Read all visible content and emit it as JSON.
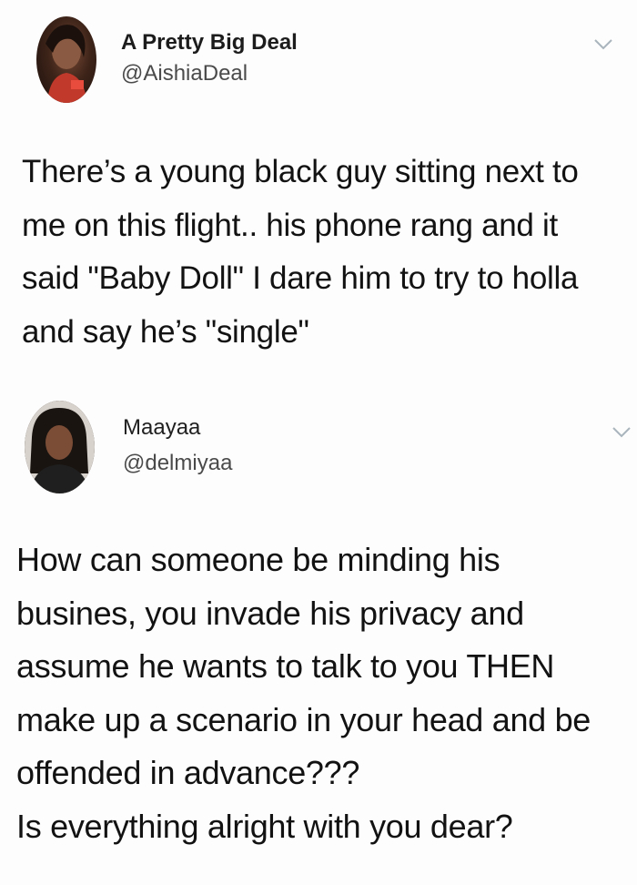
{
  "tweets": [
    {
      "display_name": "A Pretty Big Deal",
      "handle": "@AishiaDeal",
      "text": "There’s a young black guy sitting next to me on this flight.. his phone rang and it said \"Baby Doll\" I dare him to try to holla and say he’s \"single\""
    },
    {
      "display_name": "Maayaa",
      "handle": "@delmiyaa",
      "text_lines": [
        "How can someone be minding his busines, you invade his privacy and assume he wants to talk to you THEN make up a scenario in your head and be offended in advance???",
        "Is everything alright with you dear?"
      ]
    }
  ],
  "icons": {
    "menu": "chevron-down-icon",
    "avatar": "profile-photo"
  },
  "colors": {
    "background": "#fdfdfd",
    "text": "#121212",
    "handle": "#4a4a4a",
    "chevron": "#a9b4bd"
  }
}
